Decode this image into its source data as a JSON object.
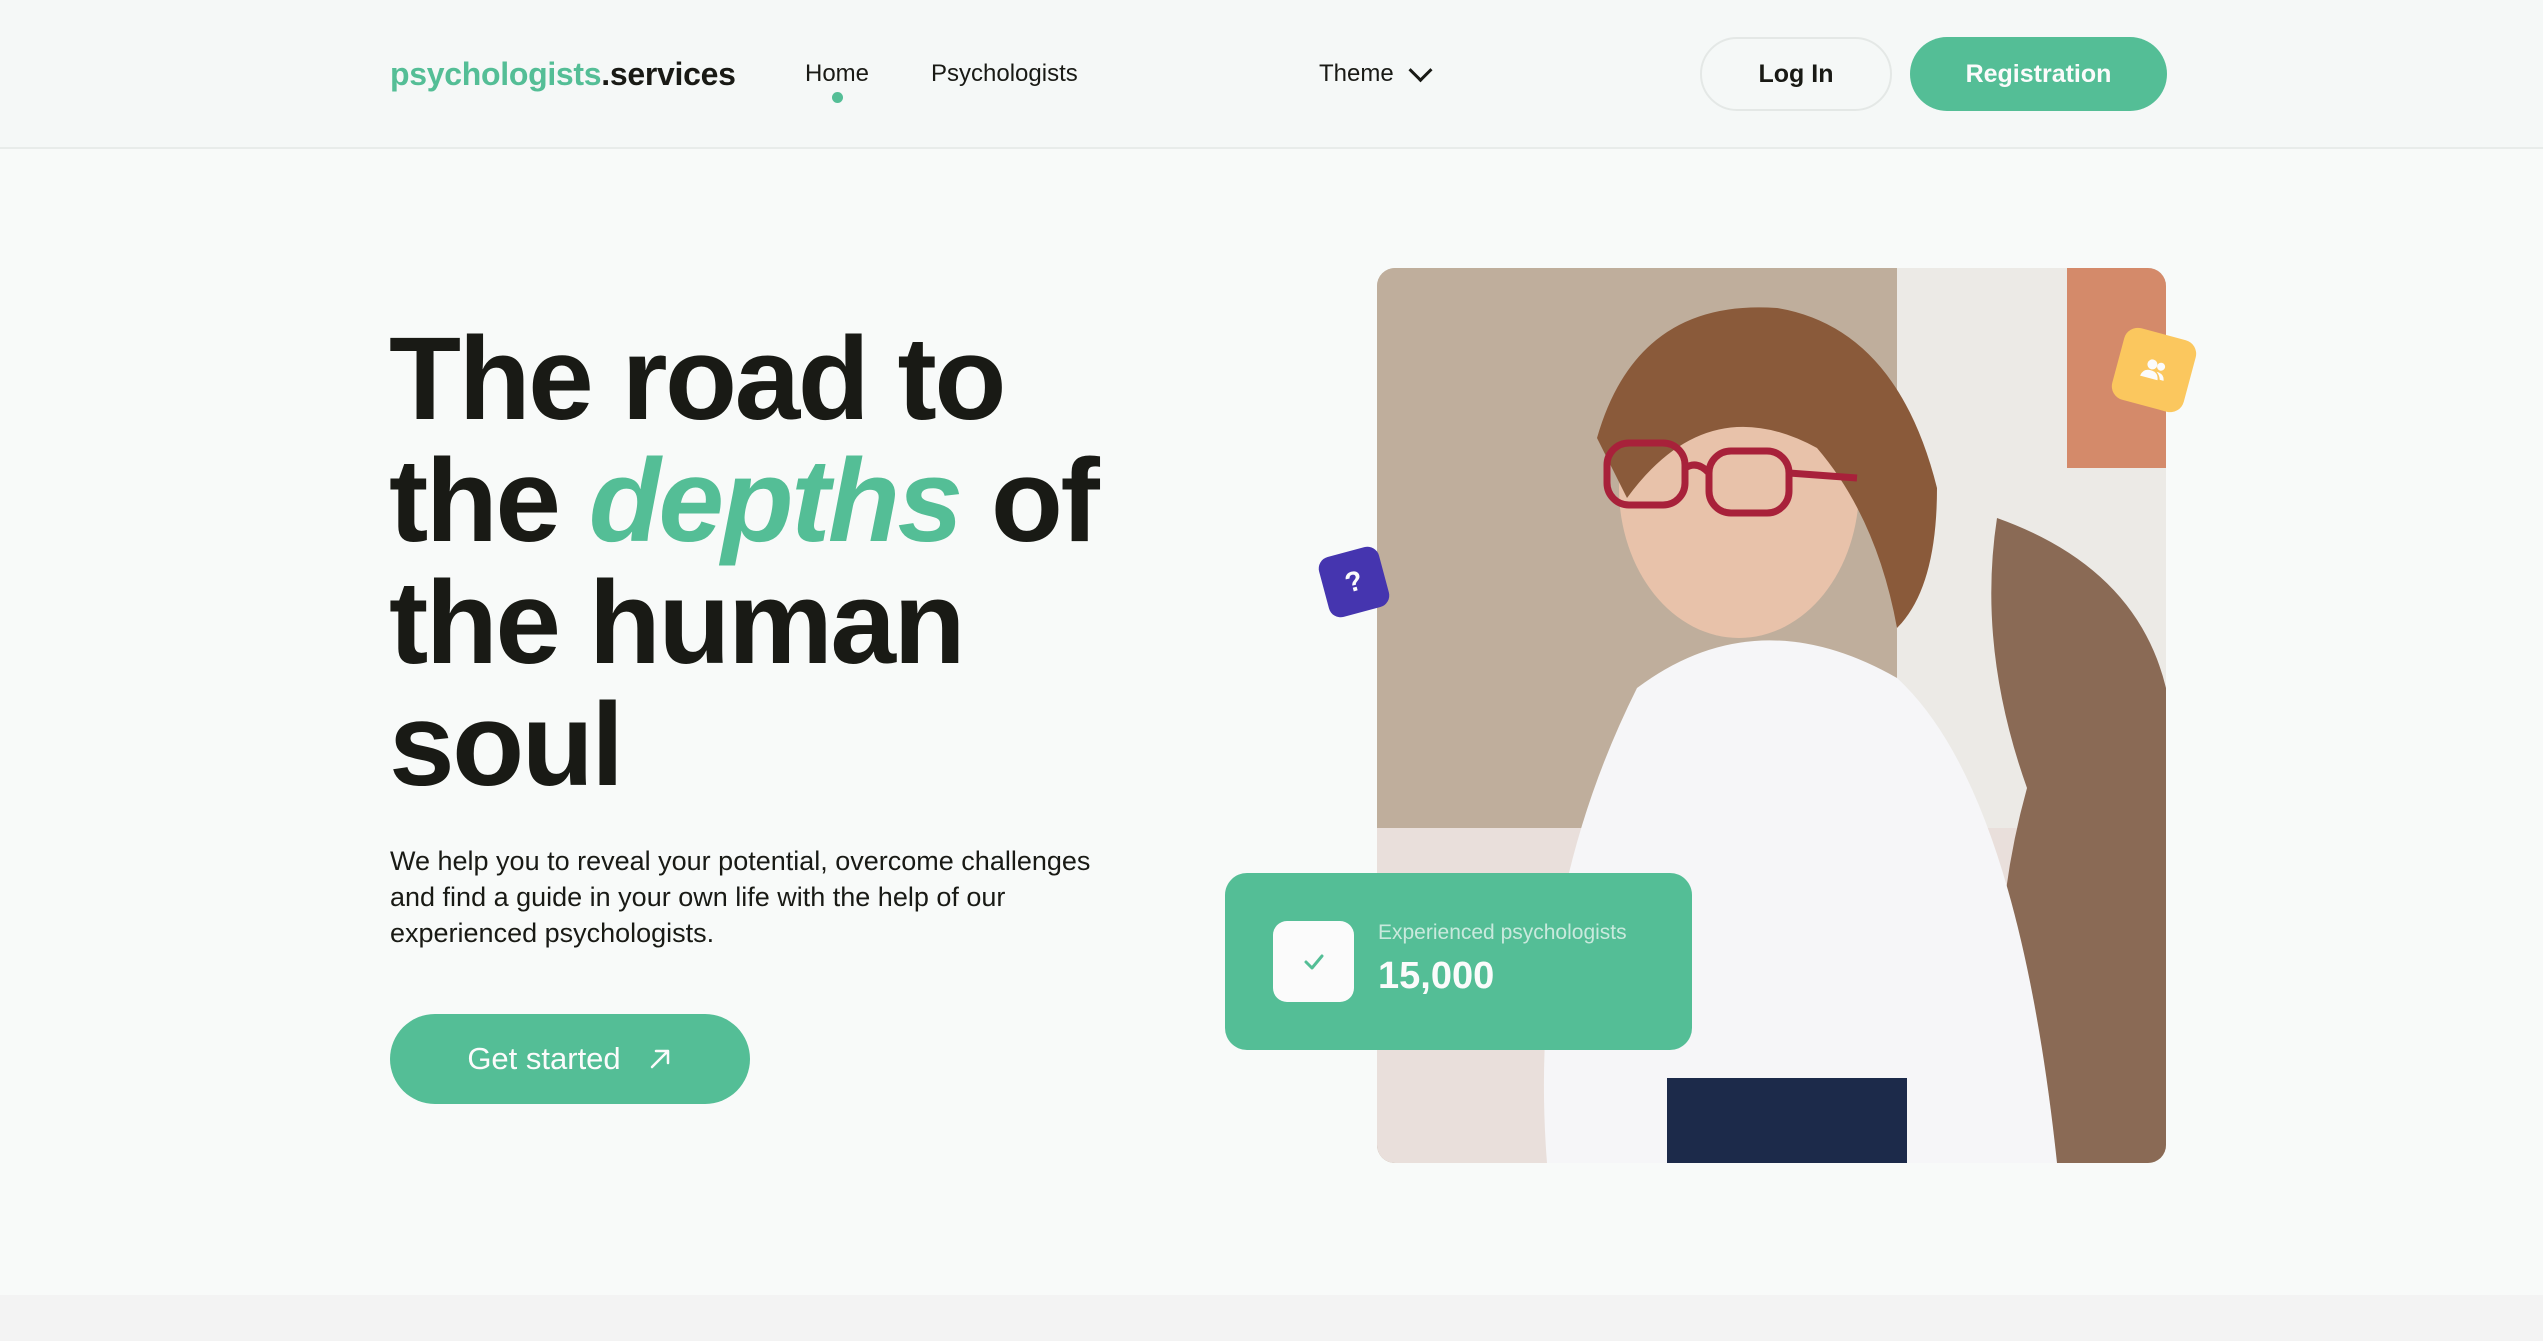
{
  "header": {
    "logo": {
      "accent": "psychologists",
      "rest": ".services"
    },
    "nav": [
      {
        "label": "Home",
        "active": true
      },
      {
        "label": "Psychologists",
        "active": false
      }
    ],
    "theme_label": "Theme",
    "login_label": "Log In",
    "register_label": "Registration"
  },
  "hero": {
    "title_line1": "The road to",
    "title_the": "the",
    "title_accent": "depths",
    "title_of": "of",
    "title_line3": "the human",
    "title_line4": "soul",
    "description": "We help you to reveal your potential, overcome challenges and find a guide in your own life with the help of our experienced psychologists.",
    "cta_label": "Get started"
  },
  "stats": {
    "label": "Experienced psychologists",
    "value": "15,000"
  },
  "badges": {
    "question": "?"
  },
  "icons": {
    "chevron": "chevron-down-icon",
    "arrow": "arrow-up-right-icon",
    "users": "users-icon",
    "check": "check-icon"
  },
  "colors": {
    "accent": "#54be96",
    "text": "#191a15",
    "yellow": "#fbc75e",
    "purple": "#4535af",
    "background": "#f8faf9"
  }
}
